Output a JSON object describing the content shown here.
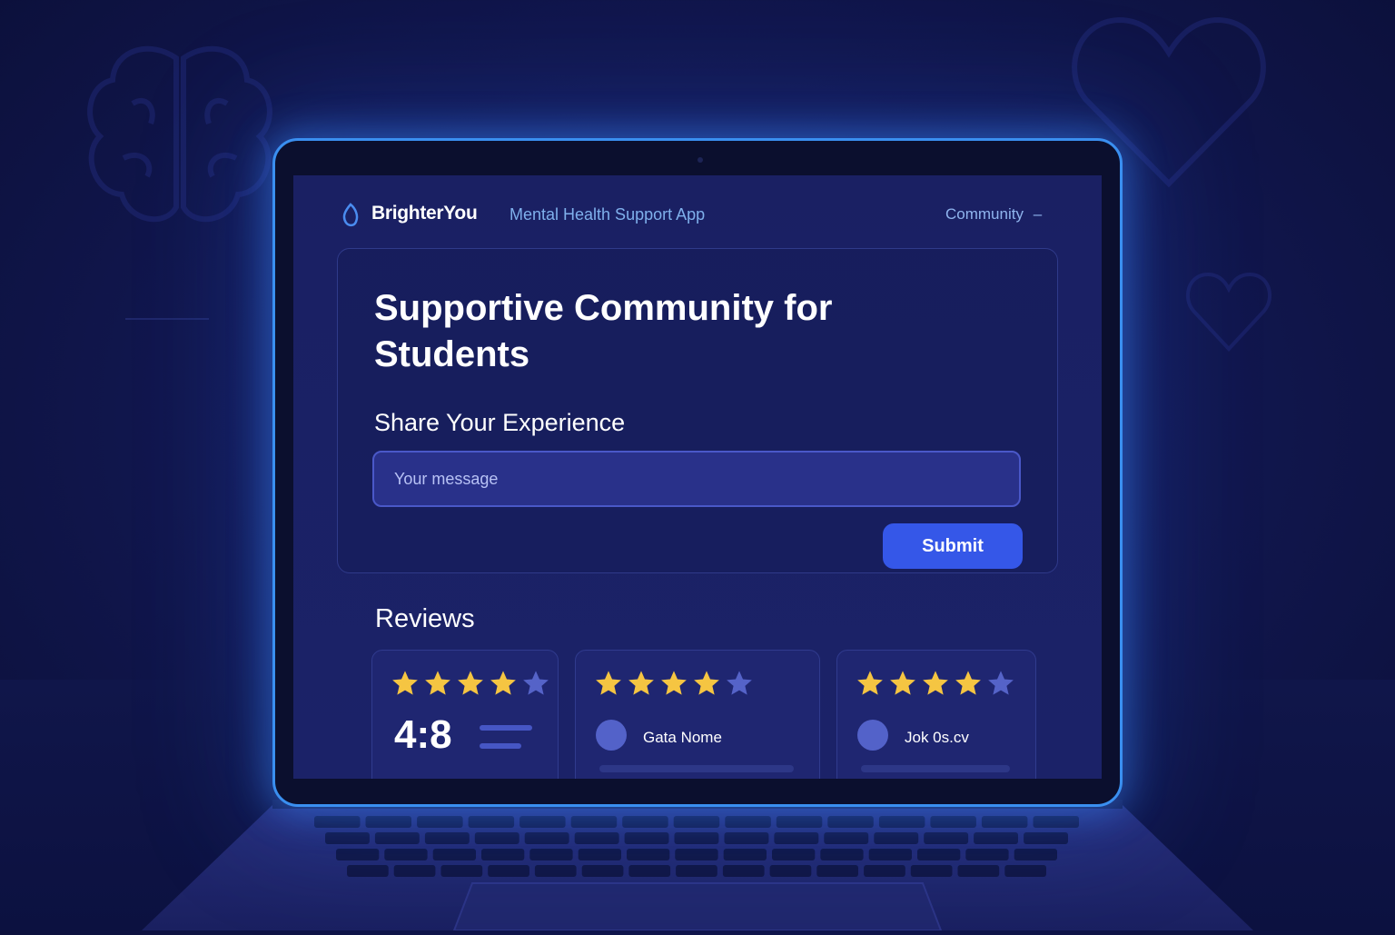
{
  "app": {
    "brand": "BrighterYou",
    "tagline": "Mental Health Support App",
    "nav_community": "Community",
    "nav_chevron": "–"
  },
  "main": {
    "title": "Supportive Community for Students",
    "share_label": "Share Your Experience",
    "message_placeholder": "Your message",
    "submit_label": "Submit"
  },
  "reviews": {
    "heading": "Reviews",
    "cards": [
      {
        "stars_filled": 4,
        "stars_total": 5,
        "rating": "4:8"
      },
      {
        "stars_filled": 4,
        "stars_total": 5,
        "name": "Gata Nome"
      },
      {
        "stars_filled": 4,
        "stars_total": 5,
        "name": "Jok 0s.cv"
      }
    ]
  },
  "colors": {
    "accent": "#3557e8",
    "star": "#f5c542",
    "star_empty": "#5563c8",
    "glow": "#3a8ff0"
  },
  "icons": {
    "logo": "leaf-drop-icon",
    "background": [
      "brain-icon",
      "heart-icon"
    ]
  }
}
